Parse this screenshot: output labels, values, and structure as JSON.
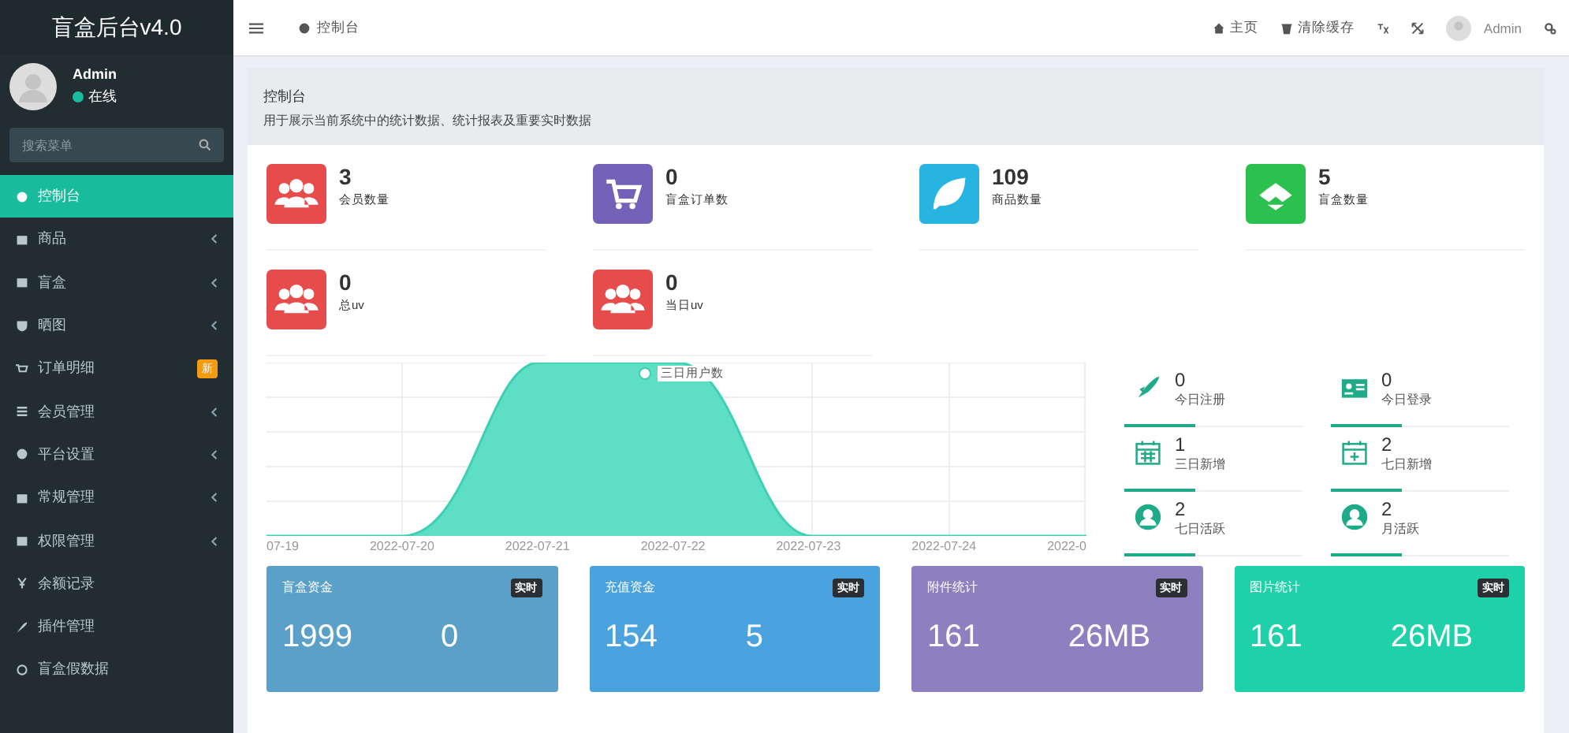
{
  "sidebar": {
    "logo": "盲盒后台v4.0",
    "user": {
      "name": "Admin",
      "status": "在线"
    },
    "search": {
      "placeholder": "搜索菜单"
    },
    "items": [
      {
        "label": "控制台",
        "selected": true,
        "expandable": false
      },
      {
        "label": "商品",
        "selected": false,
        "expandable": true
      },
      {
        "label": "盲盒",
        "selected": false,
        "expandable": true
      },
      {
        "label": "晒图",
        "selected": false,
        "expandable": true
      },
      {
        "label": "订单明细",
        "selected": false,
        "expandable": false,
        "badge": "新"
      },
      {
        "label": "会员管理",
        "selected": false,
        "expandable": true
      },
      {
        "label": "平台设置",
        "selected": false,
        "expandable": true
      },
      {
        "label": "常规管理",
        "selected": false,
        "expandable": true
      },
      {
        "label": "权限管理",
        "selected": false,
        "expandable": true
      },
      {
        "label": "余额记录",
        "selected": false,
        "expandable": false
      },
      {
        "label": "插件管理",
        "selected": false,
        "expandable": false
      },
      {
        "label": "盲盒假数据",
        "selected": false,
        "expandable": false
      }
    ]
  },
  "topbar": {
    "tab": "控制台",
    "links": [
      "主页",
      "清除缓存"
    ],
    "user": "Admin"
  },
  "panel": {
    "title": "控制台",
    "description": "用于展示当前系统中的统计数据、统计报表及重要实时数据"
  },
  "stats": [
    {
      "value": "3",
      "label": "会员数量",
      "color": "#e74c4c"
    },
    {
      "value": "0",
      "label": "盲盒订单数",
      "color": "#7461b8"
    },
    {
      "value": "109",
      "label": "商品数量",
      "color": "#27b4e0"
    },
    {
      "value": "5",
      "label": "盲盒数量",
      "color": "#2cc04f"
    },
    {
      "value": "0",
      "label": "总uv",
      "color": "#e74c4c"
    },
    {
      "value": "0",
      "label": "当日uv",
      "color": "#e74c4c"
    }
  ],
  "chart": {
    "legend": "三日用户数",
    "x_labels": [
      "07-19",
      "2022-07-20",
      "2022-07-21",
      "2022-07-22",
      "2022-07-23",
      "2022-07-24",
      "2022-0"
    ]
  },
  "mini_stats": [
    {
      "value": "0",
      "label": "今日注册"
    },
    {
      "value": "0",
      "label": "今日登录"
    },
    {
      "value": "1",
      "label": "三日新增"
    },
    {
      "value": "2",
      "label": "七日新增"
    },
    {
      "value": "2",
      "label": "七日活跃"
    },
    {
      "value": "2",
      "label": "月活跃"
    }
  ],
  "money_cards": [
    {
      "title": "盲盒资金",
      "badge": "实时",
      "values": [
        "1999",
        "0"
      ],
      "color": "#5aa0c8"
    },
    {
      "title": "充值资金",
      "badge": "实时",
      "values": [
        "154",
        "5"
      ],
      "color": "#4aa3df"
    },
    {
      "title": "附件统计",
      "badge": "实时",
      "values": [
        "161",
        "26MB"
      ],
      "color": "#8e7fc0"
    },
    {
      "title": "图片统计",
      "badge": "实时",
      "values": [
        "161",
        "26MB"
      ],
      "color": "#1fd1a8"
    }
  ]
}
